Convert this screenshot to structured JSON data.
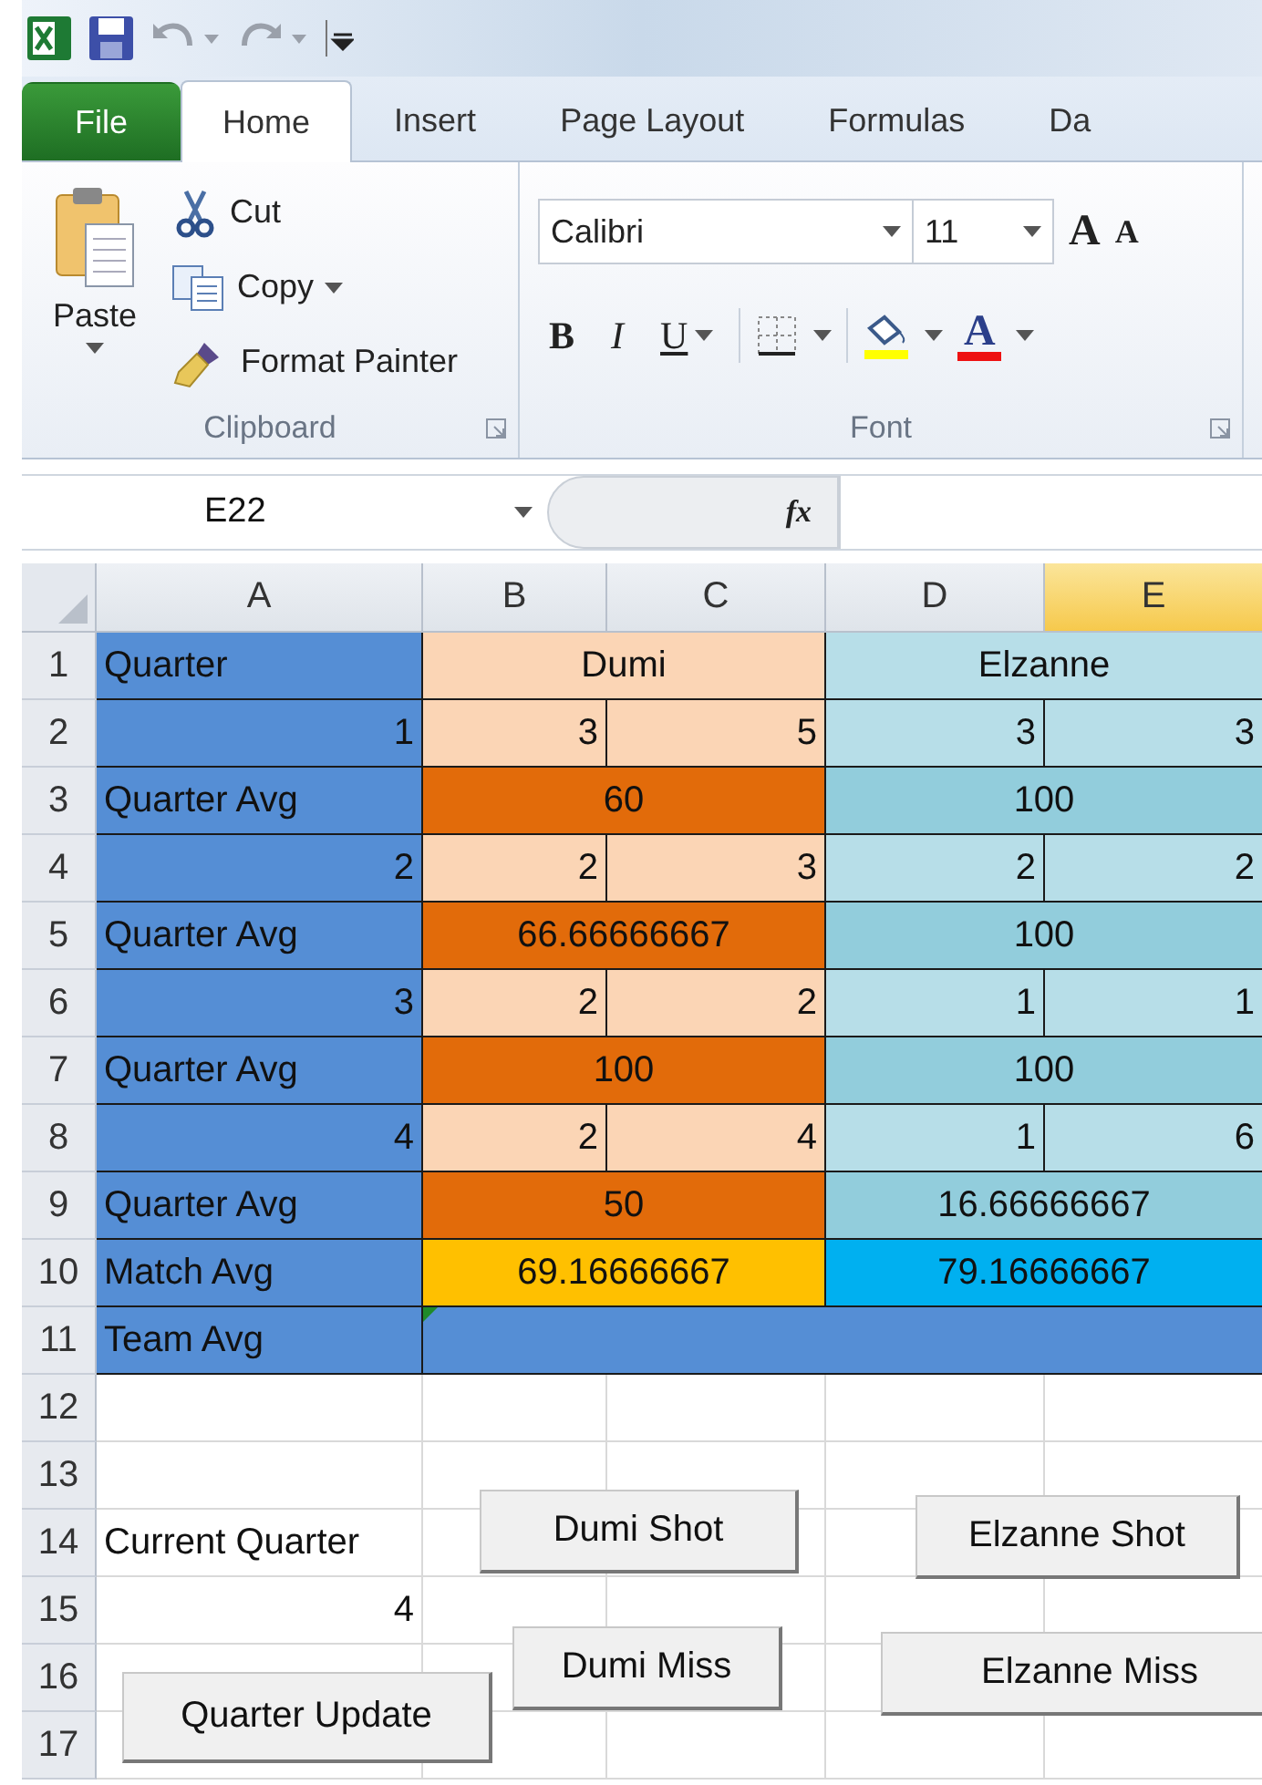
{
  "tabs": [
    {
      "label": "File",
      "kind": "file",
      "selected": false
    },
    {
      "label": "Home",
      "kind": "tab",
      "selected": true
    },
    {
      "label": "Insert",
      "kind": "tab",
      "selected": false
    },
    {
      "label": "Page Layout",
      "kind": "tab",
      "selected": false
    },
    {
      "label": "Formulas",
      "kind": "tab",
      "selected": false
    },
    {
      "label": "Da",
      "kind": "tab",
      "selected": false
    }
  ],
  "clipboard": {
    "paste": "Paste",
    "items": [
      {
        "label": "Cut",
        "kind": "cut",
        "dropdown": false
      },
      {
        "label": "Copy",
        "kind": "copy",
        "dropdown": true
      },
      {
        "label": "Format Painter",
        "kind": "painter",
        "dropdown": false
      }
    ],
    "title": "Clipboard"
  },
  "font": {
    "font_name": "Calibri",
    "font_size": "11",
    "grow": "A",
    "shrink": "A",
    "format_buttons": [
      {
        "label": "B",
        "kind": "bold",
        "dropdown": false
      },
      {
        "label": "I",
        "kind": "italic",
        "dropdown": false
      },
      {
        "label": "U",
        "kind": "underline",
        "dropdown": true
      }
    ],
    "font_color": "A",
    "title": "Font"
  },
  "formula_bar": {
    "name_box": "E22",
    "function_label": "fx"
  },
  "columns": [
    {
      "label": "A",
      "selected": false
    },
    {
      "label": "B",
      "selected": false
    },
    {
      "label": "C",
      "selected": false
    },
    {
      "label": "D",
      "selected": false
    },
    {
      "label": "E",
      "selected": true
    }
  ],
  "rows": [
    {
      "number": "1",
      "cells": [
        {
          "text": "Quarter",
          "kind": "label",
          "color": "#558ed5"
        },
        {
          "text": "Dumi",
          "kind": "centered",
          "color": "#fbd5b5"
        },
        {
          "merged": true
        },
        {
          "text": "Elzanne",
          "kind": "centered",
          "color": "#b7dee8"
        },
        {
          "merged": true
        }
      ]
    },
    {
      "number": "2",
      "cells": [
        {
          "text": "1",
          "kind": "number",
          "color": "#558ed5"
        },
        {
          "text": "3",
          "kind": "number",
          "color": "#fbd5b5"
        },
        {
          "text": "5",
          "kind": "number",
          "color": "#fbd5b5"
        },
        {
          "text": "3",
          "kind": "number",
          "color": "#b7dee8"
        },
        {
          "text": "3",
          "kind": "number",
          "color": "#b7dee8"
        }
      ]
    },
    {
      "number": "3",
      "cells": [
        {
          "text": "Quarter Avg",
          "kind": "label",
          "color": "#558ed5"
        },
        {
          "text": "60",
          "kind": "centered",
          "color": "#e26b0a"
        },
        {
          "merged": true
        },
        {
          "text": "100",
          "kind": "centered",
          "color": "#92cddc"
        },
        {
          "merged": true
        }
      ]
    },
    {
      "number": "4",
      "cells": [
        {
          "text": "2",
          "kind": "number",
          "color": "#558ed5"
        },
        {
          "text": "2",
          "kind": "number",
          "color": "#fbd5b5"
        },
        {
          "text": "3",
          "kind": "number",
          "color": "#fbd5b5"
        },
        {
          "text": "2",
          "kind": "number",
          "color": "#b7dee8"
        },
        {
          "text": "2",
          "kind": "number",
          "color": "#b7dee8"
        }
      ]
    },
    {
      "number": "5",
      "cells": [
        {
          "text": "Quarter Avg",
          "kind": "label",
          "color": "#558ed5"
        },
        {
          "text": "66.66666667",
          "kind": "centered",
          "color": "#e26b0a"
        },
        {
          "merged": true
        },
        {
          "text": "100",
          "kind": "centered",
          "color": "#92cddc"
        },
        {
          "merged": true
        }
      ]
    },
    {
      "number": "6",
      "cells": [
        {
          "text": "3",
          "kind": "number",
          "color": "#558ed5"
        },
        {
          "text": "2",
          "kind": "number",
          "color": "#fbd5b5"
        },
        {
          "text": "2",
          "kind": "number",
          "color": "#fbd5b5"
        },
        {
          "text": "1",
          "kind": "number",
          "color": "#b7dee8"
        },
        {
          "text": "1",
          "kind": "number",
          "color": "#b7dee8"
        }
      ]
    },
    {
      "number": "7",
      "cells": [
        {
          "text": "Quarter Avg",
          "kind": "label",
          "color": "#558ed5"
        },
        {
          "text": "100",
          "kind": "centered",
          "color": "#e26b0a"
        },
        {
          "merged": true
        },
        {
          "text": "100",
          "kind": "centered",
          "color": "#92cddc"
        },
        {
          "merged": true
        }
      ]
    },
    {
      "number": "8",
      "cells": [
        {
          "text": "4",
          "kind": "number",
          "color": "#558ed5"
        },
        {
          "text": "2",
          "kind": "number",
          "color": "#fbd5b5"
        },
        {
          "text": "4",
          "kind": "number",
          "color": "#fbd5b5"
        },
        {
          "text": "1",
          "kind": "number",
          "color": "#b7dee8"
        },
        {
          "text": "6",
          "kind": "number",
          "color": "#b7dee8"
        }
      ]
    },
    {
      "number": "9",
      "cells": [
        {
          "text": "Quarter Avg",
          "kind": "label",
          "color": "#558ed5"
        },
        {
          "text": "50",
          "kind": "centered",
          "color": "#e26b0a"
        },
        {
          "merged": true
        },
        {
          "text": "16.66666667",
          "kind": "centered",
          "color": "#92cddc"
        },
        {
          "merged": true
        }
      ]
    },
    {
      "number": "10",
      "cells": [
        {
          "text": "Match Avg",
          "kind": "label",
          "color": "#558ed5"
        },
        {
          "text": "69.16666667",
          "kind": "centered",
          "color": "#ffc000"
        },
        {
          "merged": true
        },
        {
          "text": "79.16666667",
          "kind": "centered",
          "color": "#00b0f0"
        },
        {
          "merged": true
        }
      ]
    },
    {
      "number": "11",
      "cells": [
        {
          "text": "Team Avg",
          "kind": "label",
          "color": "#558ed5"
        },
        {
          "kind": "centered",
          "color": "#558ed5",
          "error_flag": true
        },
        {
          "merged": true
        },
        {
          "merged": true
        },
        {
          "merged": true
        }
      ]
    },
    {
      "number": "12"
    },
    {
      "number": "13"
    },
    {
      "number": "14",
      "cells": [
        {
          "text": "Current Quarter",
          "kind": "label"
        }
      ]
    },
    {
      "number": "15",
      "cells": [
        {
          "text": "4",
          "kind": "number"
        }
      ]
    },
    {
      "number": "16"
    },
    {
      "number": "17"
    }
  ],
  "form_buttons": [
    {
      "label": "Dumi Shot"
    },
    {
      "label": "Elzanne Shot"
    },
    {
      "label": "Dumi Miss"
    },
    {
      "label": "Elzanne Miss"
    },
    {
      "label": "Quarter Update"
    }
  ]
}
